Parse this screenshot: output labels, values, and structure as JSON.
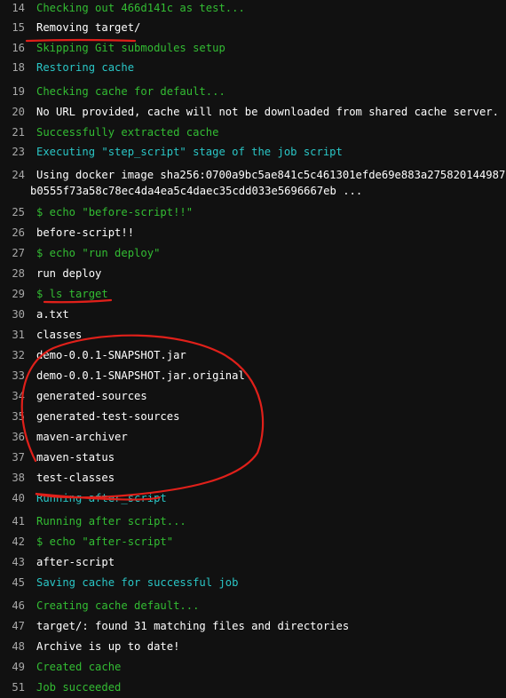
{
  "lines": [
    {
      "num": "14",
      "text": "Checking out 466d141c as test...",
      "color": "green"
    },
    {
      "num": "15",
      "text": "Removing target/",
      "color": "white"
    },
    {
      "num": "16",
      "text": "Skipping Git submodules setup",
      "color": "green"
    },
    {
      "num": "18",
      "text": "Restoring cache",
      "color": "cyan"
    },
    {
      "num": "19",
      "text": "Checking cache for default...",
      "color": "green"
    },
    {
      "num": "20",
      "text": "No URL provided, cache will not be downloaded from shared cache server. Inst",
      "color": "white"
    },
    {
      "num": "21",
      "text": "Successfully extracted cache",
      "color": "green"
    },
    {
      "num": "23",
      "text": "Executing \"step_script\" stage of the job script",
      "color": "cyan"
    },
    {
      "num": "24",
      "text": "Using docker image sha256:0700a9bc5ae841c5c461301efde69e883a27582014498732819",
      "color": "white"
    },
    {
      "num": "25",
      "text": "$ echo \"before-script!!\"",
      "color": "green"
    },
    {
      "num": "26",
      "text": "before-script!!",
      "color": "white"
    },
    {
      "num": "27",
      "text": "$ echo \"run deploy\"",
      "color": "green"
    },
    {
      "num": "28",
      "text": "run deploy",
      "color": "white"
    },
    {
      "num": "29",
      "text": "$ ls target",
      "color": "green"
    },
    {
      "num": "30",
      "text": "a.txt",
      "color": "white"
    },
    {
      "num": "31",
      "text": "classes",
      "color": "white"
    },
    {
      "num": "32",
      "text": "demo-0.0.1-SNAPSHOT.jar",
      "color": "white"
    },
    {
      "num": "33",
      "text": "demo-0.0.1-SNAPSHOT.jar.original",
      "color": "white"
    },
    {
      "num": "34",
      "text": "generated-sources",
      "color": "white"
    },
    {
      "num": "35",
      "text": "generated-test-sources",
      "color": "white"
    },
    {
      "num": "36",
      "text": "maven-archiver",
      "color": "white"
    },
    {
      "num": "37",
      "text": "maven-status",
      "color": "white"
    },
    {
      "num": "38",
      "text": "test-classes",
      "color": "white"
    },
    {
      "num": "40",
      "text": "Running after_script",
      "color": "cyan"
    },
    {
      "num": "41",
      "text": "Running after script...",
      "color": "green"
    },
    {
      "num": "42",
      "text": "$ echo \"after-script\"",
      "color": "green"
    },
    {
      "num": "43",
      "text": "after-script",
      "color": "white"
    },
    {
      "num": "45",
      "text": "Saving cache for successful job",
      "color": "cyan"
    },
    {
      "num": "46",
      "text": "Creating cache default...",
      "color": "green"
    },
    {
      "num": "47",
      "text": "target/: found 31 matching files and directories",
      "color": "white"
    },
    {
      "num": "48",
      "text": "Archive is up to date!",
      "color": "white"
    },
    {
      "num": "49",
      "text": "Created cache",
      "color": "green"
    },
    {
      "num": "51",
      "text": "Job succeeded",
      "color": "green"
    }
  ],
  "wrapped": {
    "text": "b0555f73a58c78ec4da4ea5c4daec35cdd033e5696667eb ..."
  },
  "colors": {
    "background": "#111111",
    "green": "#33bd33",
    "cyan": "#2ac6c6",
    "white": "#ffffff",
    "line_number": "#a8a8a8",
    "annotation": "#e0201a"
  }
}
